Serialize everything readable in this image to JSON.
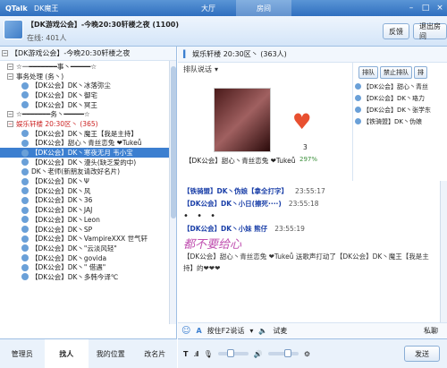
{
  "app": {
    "name": "QTalk",
    "window_title": "DK魔王"
  },
  "tabs": [
    "大厅",
    "房间"
  ],
  "header": {
    "room_name": "【DK游戏公会】-今晚20:30轩楼之夜",
    "room_id": "(1100)",
    "online": "在线: 401人",
    "feedback_label": "反馈",
    "exit_label": "退出房间"
  },
  "left": {
    "room_label": "【DK游戏公会】-今晚20:30轩楼之夜",
    "tree": [
      {
        "pm": "−",
        "text": "☆一━━━━━━━事丶━━━━━☆",
        "type": "group"
      },
      {
        "pm": "−",
        "text": "事务处理   (务丶)",
        "type": "group"
      },
      {
        "text": "【DK公会】DK丶冰落弥尘",
        "type": "member"
      },
      {
        "text": "【DK公会】DK丶御宅",
        "type": "member"
      },
      {
        "text": "【DK公会】DK丶冥王",
        "type": "member"
      },
      {
        "pm": "−",
        "text": "☆━━━━━━━务丶━━━━━☆",
        "type": "group"
      },
      {
        "pm": "−",
        "text": "娱乐轩楼   20:30区丶   (365)",
        "type": "group",
        "red": true
      },
      {
        "text": "【DK公会】DK丶魔王【我是主持】",
        "type": "member"
      },
      {
        "text": "【DK公会】甜心丶青丝恋兔 ❤Tukeǚ",
        "type": "member"
      },
      {
        "text": "【DK公会】DK丶寒夜无月   韦小宝",
        "type": "member",
        "selected": true
      },
      {
        "text": "【DK公会】DK丶漫头(缺乏爱的中)",
        "type": "member"
      },
      {
        "text": "DK丶老师(新朋友请改好名片)",
        "type": "member"
      },
      {
        "text": "【DK公会】DK丶Ψ",
        "type": "member"
      },
      {
        "text": "【DK公会】DK丶风",
        "type": "member"
      },
      {
        "text": "【DK公会】DK丶36",
        "type": "member"
      },
      {
        "text": "【DK公会】DK丶JAJ",
        "type": "member"
      },
      {
        "text": "【DK公会】DK丶Leon",
        "type": "member"
      },
      {
        "text": "【DK公会】DK丶SP",
        "type": "member"
      },
      {
        "text": "【DK公会】DK丶VampireXXX 世气轩",
        "type": "member"
      },
      {
        "text": "【DK公会】DK丶\"云淡风轻\"",
        "type": "member"
      },
      {
        "text": "【DK公会】DK丶govida",
        "type": "member"
      },
      {
        "text": "【DK公会】DK丶\" 借遇\"",
        "type": "member"
      },
      {
        "text": "【DK公会】DK丶多韩今译℃",
        "type": "member"
      }
    ]
  },
  "bottom_tabs": [
    "管理员",
    "找人",
    "我的位置",
    "改名片"
  ],
  "bottom_tab_active": 1,
  "right": {
    "channel": "娱乐轩楼   20:30区丶   (363人)",
    "mode": "排队说话",
    "mic_count": "3",
    "mic_user": "【DK公会】甜心丶青丝恋兔 ❤Tukeǚ",
    "signal": "297%",
    "queue_buttons": [
      "排队",
      "禁止排队",
      "排"
    ],
    "queue": [
      "【DK公会】甜心丶青丝",
      "【DK公会】DK丶珞力",
      "【DK公会】DK丶张学东",
      "【铁骑盟】DK丶伪娘"
    ],
    "chat": [
      {
        "who": "【铁骑盟】DK丶伪娘【拿全打字】",
        "time": "23:55:17"
      },
      {
        "who": "【DK公会】DK丶小日(擦死····)",
        "time": "23:55:18"
      },
      {
        "dots": "• • •"
      },
      {
        "who": "【DK公会】DK丶小妹  熊仔",
        "time": "23:55:19"
      },
      {
        "big": "都不要给心"
      },
      {
        "gift": "【DK公会】甜心丶青丝恋兔 ❤Tukeǚ 送歌声打动了【DK公会】DK丶魔王【我是主持】的❤❤❤"
      }
    ],
    "input_mode": "按住F2说话",
    "test_label": "试麦",
    "private_label": "私聊",
    "send_label": "发送"
  }
}
